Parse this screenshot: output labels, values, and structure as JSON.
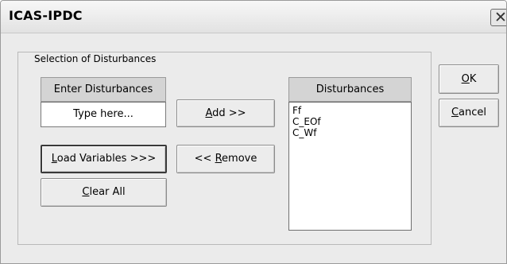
{
  "window": {
    "title": "ICAS-IPDC",
    "close_glyph": "✕"
  },
  "group": {
    "legend": "Selection of Disturbances"
  },
  "enter": {
    "header": "Enter Disturbances",
    "input_text": "Type here..."
  },
  "buttons": {
    "add": {
      "mnemonic": "A",
      "rest": "dd >>"
    },
    "load": {
      "mnemonic": "L",
      "rest": "oad Variables >>>"
    },
    "remove": {
      "prefix": "<< ",
      "mnemonic": "R",
      "rest": "emove"
    },
    "clear": {
      "mnemonic": "C",
      "rest": "lear All"
    },
    "ok": {
      "mnemonic": "O",
      "rest": "K"
    },
    "cancel": {
      "mnemonic": "C",
      "rest": "ancel"
    }
  },
  "disturbances": {
    "header": "Disturbances",
    "items": [
      "Ff",
      "C_EOf",
      "C_Wf"
    ]
  }
}
